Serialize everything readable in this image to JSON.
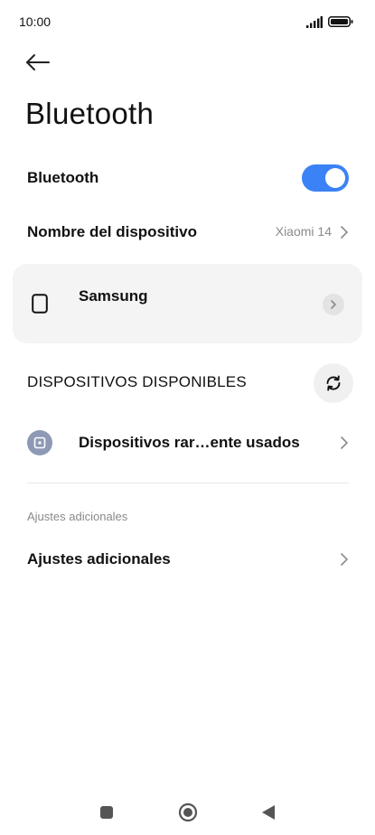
{
  "status_bar": {
    "time": "10:00",
    "icons": [
      "signal-icon",
      "battery-icon"
    ]
  },
  "header": {
    "back_icon": "arrow-left-icon",
    "title": "Bluetooth"
  },
  "bluetooth_toggle": {
    "label": "Bluetooth",
    "enabled": true,
    "accent_color": "#3b82f6"
  },
  "device_name": {
    "label": "Nombre del dispositivo",
    "value": "Xiaomi 14"
  },
  "paired_devices": [
    {
      "name": "Samsung",
      "icon": "phone-icon"
    }
  ],
  "available_devices": {
    "header": "DISPOSITIVOS DISPONIBLES",
    "refresh_icon": "refresh-icon",
    "rare_devices_label": "Dispositivos rar…ente usados"
  },
  "additional": {
    "caption": "Ajustes adicionales",
    "label": "Ajustes adicionales"
  },
  "nav_bar": {
    "icons": [
      "recents-icon",
      "home-icon",
      "back-triangle-icon"
    ]
  }
}
